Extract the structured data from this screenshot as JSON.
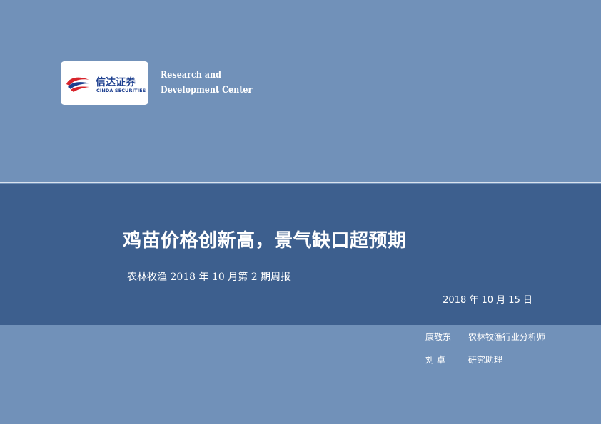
{
  "logo": {
    "name_cn": "信达证券",
    "name_en": "CINDA SECURITIES",
    "icon": "cinda-swirl-logo"
  },
  "center": {
    "line1": "Research and",
    "line2": "Development Center"
  },
  "report": {
    "title": "鸡苗价格创新高，景气缺口超预期",
    "subtitle": "农林牧渔 2018 年 10 月第 2 期周报",
    "date": "2018 年 10 月 15 日"
  },
  "analysts": [
    {
      "name": "康敬东",
      "role": "农林牧渔行业分析师"
    },
    {
      "name": "刘  卓",
      "role": "研究助理"
    }
  ],
  "colors": {
    "background": "#7191b9",
    "band": "#3d5f8e",
    "logo_blue": "#1d3f8f",
    "logo_red": "#d8242b"
  }
}
